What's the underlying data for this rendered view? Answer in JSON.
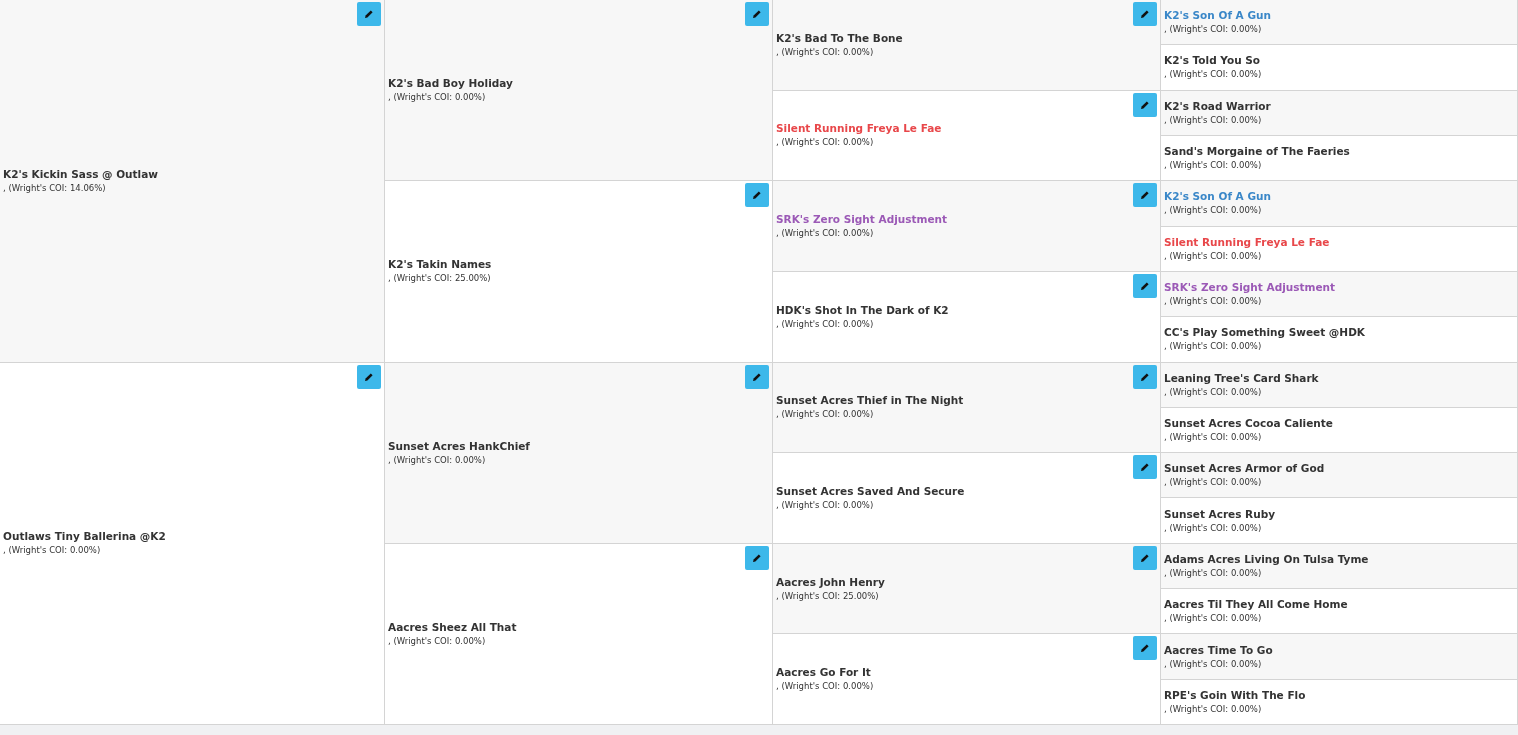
{
  "pedigree": [
    {
      "name": "K2's Kickin Sass @ Outlaw",
      "coi": ", (Wright's COI: 14.06%)",
      "color": "#333333",
      "children": [
        {
          "name": "K2's Bad Boy Holiday",
          "coi": ", (Wright's COI: 0.00%)",
          "color": "#333333",
          "children": [
            {
              "name": "K2's Bad To The Bone",
              "coi": ", (Wright's COI: 0.00%)",
              "color": "#333333",
              "children": [
                {
                  "name": "K2's Son Of A Gun",
                  "coi": ", (Wright's COI: 0.00%)",
                  "color": "#3a87c8"
                },
                {
                  "name": "K2's Told You So",
                  "coi": ", (Wright's COI: 0.00%)",
                  "color": "#333333"
                }
              ]
            },
            {
              "name": "Silent Running Freya Le Fae",
              "coi": ", (Wright's COI: 0.00%)",
              "color": "#e8474a",
              "children": [
                {
                  "name": "K2's Road Warrior",
                  "coi": ", (Wright's COI: 0.00%)",
                  "color": "#333333"
                },
                {
                  "name": "Sand's Morgaine of The Faeries",
                  "coi": ", (Wright's COI: 0.00%)",
                  "color": "#333333"
                }
              ]
            }
          ]
        },
        {
          "name": "K2's Takin Names",
          "coi": ", (Wright's COI: 25.00%)",
          "color": "#333333",
          "children": [
            {
              "name": "SRK's Zero Sight Adjustment",
              "coi": ", (Wright's COI: 0.00%)",
              "color": "#9b59b6",
              "children": [
                {
                  "name": "K2's Son Of A Gun",
                  "coi": ", (Wright's COI: 0.00%)",
                  "color": "#3a87c8"
                },
                {
                  "name": "Silent Running Freya Le Fae",
                  "coi": ", (Wright's COI: 0.00%)",
                  "color": "#e8474a"
                }
              ]
            },
            {
              "name": "HDK's Shot In The Dark of K2",
              "coi": ", (Wright's COI: 0.00%)",
              "color": "#333333",
              "children": [
                {
                  "name": "SRK's Zero Sight Adjustment",
                  "coi": ", (Wright's COI: 0.00%)",
                  "color": "#9b59b6"
                },
                {
                  "name": "CC's Play Something Sweet @HDK",
                  "coi": ", (Wright's COI: 0.00%)",
                  "color": "#333333"
                }
              ]
            }
          ]
        }
      ]
    },
    {
      "name": "Outlaws Tiny Ballerina @K2",
      "coi": ", (Wright's COI: 0.00%)",
      "color": "#333333",
      "children": [
        {
          "name": "Sunset Acres HankChief",
          "coi": ", (Wright's COI: 0.00%)",
          "color": "#333333",
          "children": [
            {
              "name": "Sunset Acres Thief in The Night",
              "coi": ", (Wright's COI: 0.00%)",
              "color": "#333333",
              "children": [
                {
                  "name": "Leaning Tree's Card Shark",
                  "coi": ", (Wright's COI: 0.00%)",
                  "color": "#333333"
                },
                {
                  "name": "Sunset Acres Cocoa Caliente",
                  "coi": ", (Wright's COI: 0.00%)",
                  "color": "#333333"
                }
              ]
            },
            {
              "name": "Sunset Acres Saved And Secure",
              "coi": ", (Wright's COI: 0.00%)",
              "color": "#333333",
              "children": [
                {
                  "name": "Sunset Acres Armor of God",
                  "coi": ", (Wright's COI: 0.00%)",
                  "color": "#333333"
                },
                {
                  "name": "Sunset Acres Ruby",
                  "coi": ", (Wright's COI: 0.00%)",
                  "color": "#333333"
                }
              ]
            }
          ]
        },
        {
          "name": "Aacres Sheez All That",
          "coi": ", (Wright's COI: 0.00%)",
          "color": "#333333",
          "children": [
            {
              "name": "Aacres John Henry",
              "coi": ", (Wright's COI: 25.00%)",
              "color": "#333333",
              "children": [
                {
                  "name": "Adams Acres Living On Tulsa Tyme",
                  "coi": ", (Wright's COI: 0.00%)",
                  "color": "#333333"
                },
                {
                  "name": "Aacres Til They All Come Home",
                  "coi": ", (Wright's COI: 0.00%)",
                  "color": "#333333"
                }
              ]
            },
            {
              "name": "Aacres Go For It",
              "coi": ", (Wright's COI: 0.00%)",
              "color": "#333333",
              "children": [
                {
                  "name": "Aacres Time To Go",
                  "coi": ", (Wright's COI: 0.00%)",
                  "color": "#333333"
                },
                {
                  "name": "RPE's Goin With The Flo",
                  "coi": ", (Wright's COI: 0.00%)",
                  "color": "#333333"
                }
              ]
            }
          ]
        }
      ]
    }
  ]
}
